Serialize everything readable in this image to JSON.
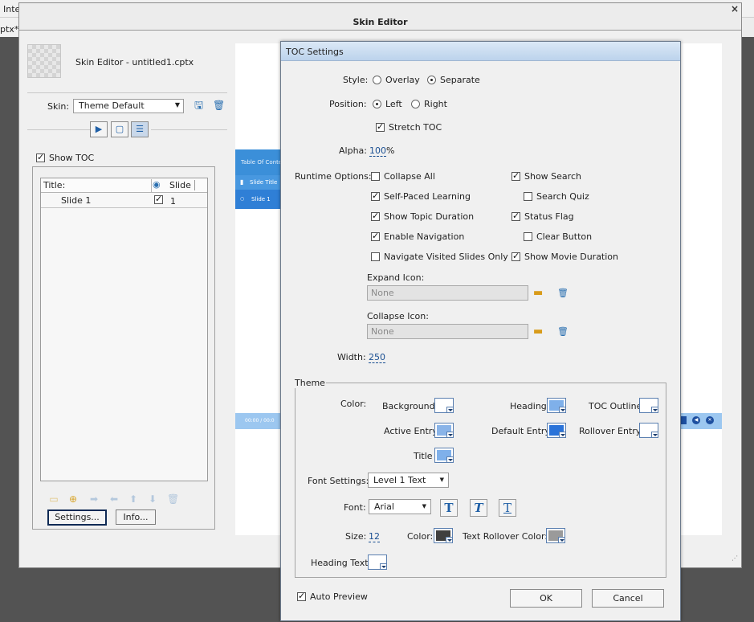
{
  "background": {
    "menu_text": "Inte",
    "file_tab": "ptx*"
  },
  "skin_editor": {
    "title": "Skin Editor",
    "close_label": "×",
    "doc_title": "Skin Editor - untitled1.cptx",
    "skin_label": "Skin:",
    "skin_value": "Theme Default",
    "show_toc_label": "Show TOC",
    "show_toc_checked": true,
    "table": {
      "col_title": "Title:",
      "col_slide": "Slide",
      "rows": [
        {
          "title": "Slide 1",
          "visible": true,
          "slide": "1"
        }
      ]
    },
    "settings_button": "Settings...",
    "info_button": "Info..."
  },
  "preview": {
    "toc_heading": "Table Of Conte",
    "row_title": "Slide Title",
    "row_slide": "Slide 1",
    "time": "00:00 / 00:0"
  },
  "toc_settings": {
    "title": "TOC Settings",
    "style_label": "Style:",
    "style_options": [
      "Overlay",
      "Separate"
    ],
    "style_selected": "Separate",
    "position_label": "Position:",
    "position_options": [
      "Left",
      "Right"
    ],
    "position_selected": "Left",
    "stretch_toc": {
      "label": "Stretch TOC",
      "checked": true
    },
    "alpha_label": "Alpha:",
    "alpha_value": "100",
    "alpha_unit": "%",
    "runtime_label": "Runtime Options:",
    "runtime_left": [
      {
        "label": "Collapse All",
        "checked": false
      },
      {
        "label": "Self-Paced Learning",
        "checked": true
      },
      {
        "label": "Show Topic Duration",
        "checked": true
      },
      {
        "label": "Enable Navigation",
        "checked": true
      },
      {
        "label": "Navigate Visited Slides Only",
        "checked": false
      }
    ],
    "runtime_right": [
      {
        "label": "Show Search",
        "checked": true
      },
      {
        "label": "Search Quiz",
        "checked": false
      },
      {
        "label": "Status Flag",
        "checked": true
      },
      {
        "label": "Clear Button",
        "checked": false
      },
      {
        "label": "Show Movie Duration",
        "checked": true
      }
    ],
    "expand_icon_label": "Expand Icon:",
    "expand_icon_value": "None",
    "collapse_icon_label": "Collapse Icon:",
    "collapse_icon_value": "None",
    "width_label": "Width:",
    "width_value": "250",
    "theme": {
      "legend": "Theme",
      "color_label": "Color:",
      "swatches": {
        "background": {
          "label": "Background",
          "color": "#ffffff"
        },
        "heading": {
          "label": "Heading",
          "color": "#7fb0ea"
        },
        "toc_outline": {
          "label": "TOC Outline",
          "color": "#ffffff"
        },
        "active_entry": {
          "label": "Active Entry",
          "color": "#8ab4e8"
        },
        "default_entry": {
          "label": "Default Entry",
          "color": "#2a73d9"
        },
        "rollover_entry": {
          "label": "Rollover Entry",
          "color": "#ffffff"
        },
        "title": {
          "label": "Title",
          "color": "#7fb0ea"
        }
      },
      "font_settings_label": "Font Settings:",
      "font_settings_value": "Level 1 Text",
      "font_label": "Font:",
      "font_value": "Arial",
      "size_label": "Size:",
      "size_value": "12",
      "color_label2": "Color:",
      "text_color": "#3f3f3f",
      "rollover_label": "Text Rollover Color:",
      "rollover_color": "#9a9a9a",
      "heading_text_label": "Heading Text",
      "heading_text_color": "#ffffff"
    },
    "auto_preview": {
      "label": "Auto Preview",
      "checked": true
    },
    "ok_button": "OK",
    "cancel_button": "Cancel"
  }
}
